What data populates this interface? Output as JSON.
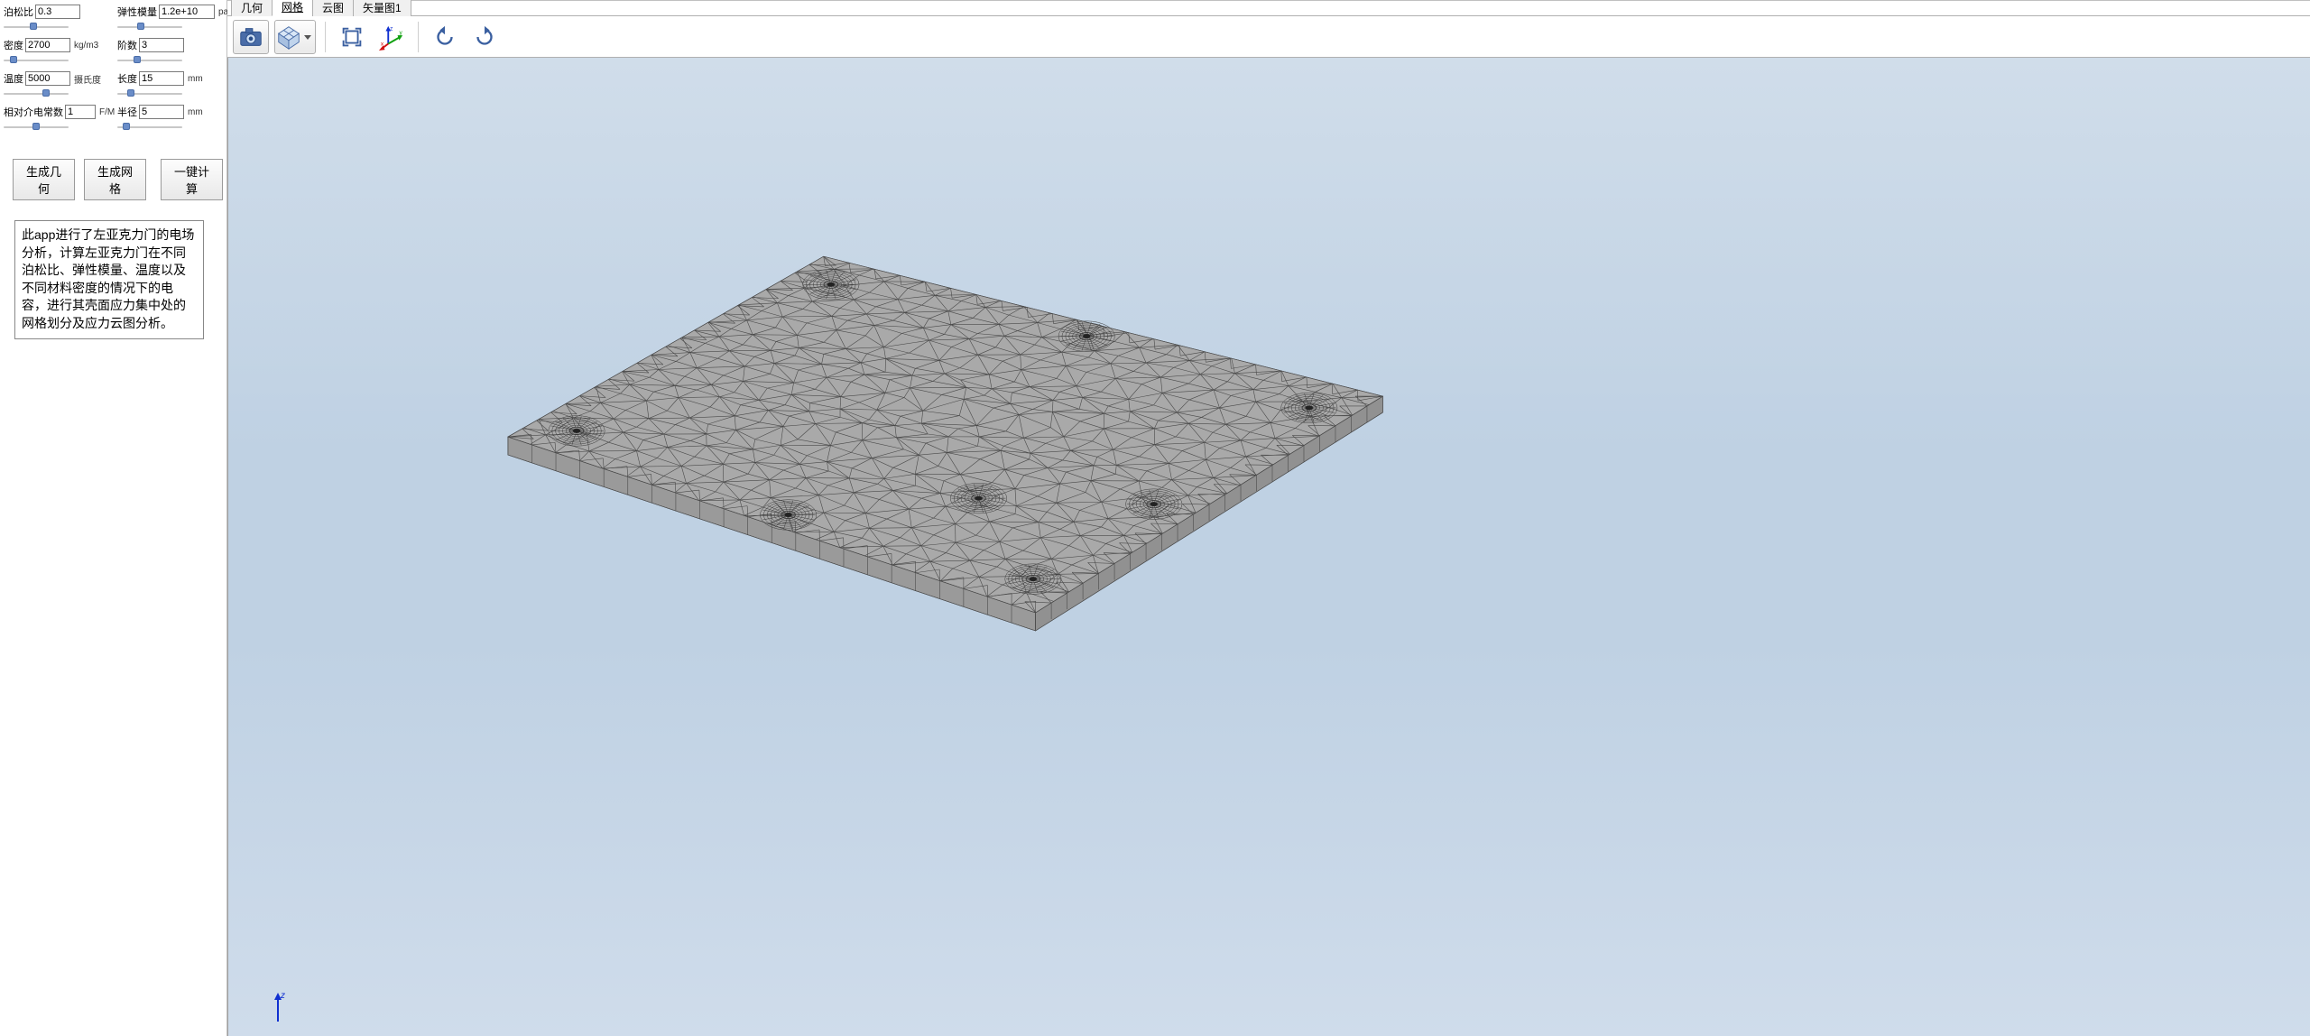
{
  "params": {
    "poisson": {
      "label": "泊松比",
      "value": "0.3",
      "unit": ""
    },
    "elastic": {
      "label": "弹性模量",
      "value": "1.2e+10",
      "unit": "pa"
    },
    "density": {
      "label": "密度",
      "value": "2700",
      "unit": "kg/m3"
    },
    "order": {
      "label": "阶数",
      "value": "3",
      "unit": ""
    },
    "temp": {
      "label": "温度",
      "value": "5000",
      "unit": "摄氏度"
    },
    "length": {
      "label": "长度",
      "value": "15",
      "unit": "mm"
    },
    "permittivity": {
      "label": "相对介电常数",
      "value": "1",
      "unit": "F/M"
    },
    "radius": {
      "label": "半径",
      "value": "5",
      "unit": "mm"
    }
  },
  "buttons": {
    "gen_geom": "生成几何",
    "gen_mesh": "生成网格",
    "compute": "一键计算"
  },
  "description": "此app进行了左亚克力门的电场分析，计算左亚克力门在不同泊松比、弹性模量、温度以及不同材料密度的情况下的电容，进行其壳面应力集中处的网格划分及应力云图分析。",
  "tabs": {
    "geometry": "几何",
    "mesh": "网格",
    "cloud": "云图",
    "vector": "矢量图1"
  },
  "active_tab": "mesh",
  "axis": {
    "x": "x",
    "y": "y",
    "z": "z"
  }
}
